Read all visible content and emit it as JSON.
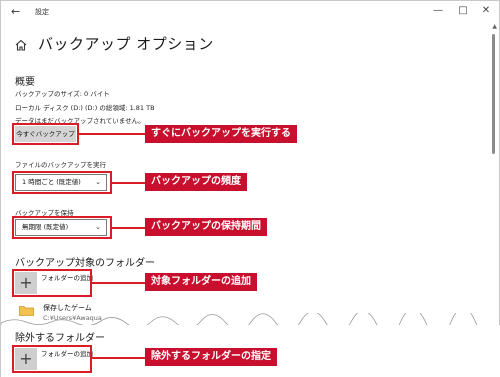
{
  "window": {
    "back_icon": "back-arrow-icon",
    "title": "設定",
    "controls": [
      "minimize-icon",
      "maximize-icon",
      "close-icon"
    ]
  },
  "page": {
    "home_icon": "home-icon",
    "title": "バックアップ オプション"
  },
  "overview": {
    "heading": "概要",
    "backup_size": "バックアップのサイズ: 0 バイト",
    "disk_space": "ローカル ディスク (D:) (D:) の総領域: 1.81 TB",
    "status": "データはまだバックアップされていません。",
    "backup_now_button": "今すぐバックアップ"
  },
  "frequency": {
    "label": "ファイルのバックアップを実行",
    "value": "1 時間ごと (既定値)"
  },
  "retention": {
    "label": "バックアップを保持",
    "value": "無期限 (既定値)"
  },
  "include_folders": {
    "heading": "バックアップ対象のフォルダー",
    "add_label": "フォルダーの追加",
    "items": [
      {
        "name": "保存したゲーム",
        "path": "C:¥Users¥Awaqua"
      }
    ]
  },
  "exclude_folders": {
    "heading": "除外するフォルダー",
    "add_label": "フォルダーの追加"
  },
  "callouts": {
    "backup_now": "すぐにバックアップを実行する",
    "frequency": "バックアップの頻度",
    "retention": "バックアップの保持期間",
    "add_target": "対象フォルダーの追加",
    "add_exclude": "除外するフォルダーの指定"
  },
  "colors": {
    "accent_red": "#c8102e",
    "button_gray": "#d4d4d4"
  }
}
